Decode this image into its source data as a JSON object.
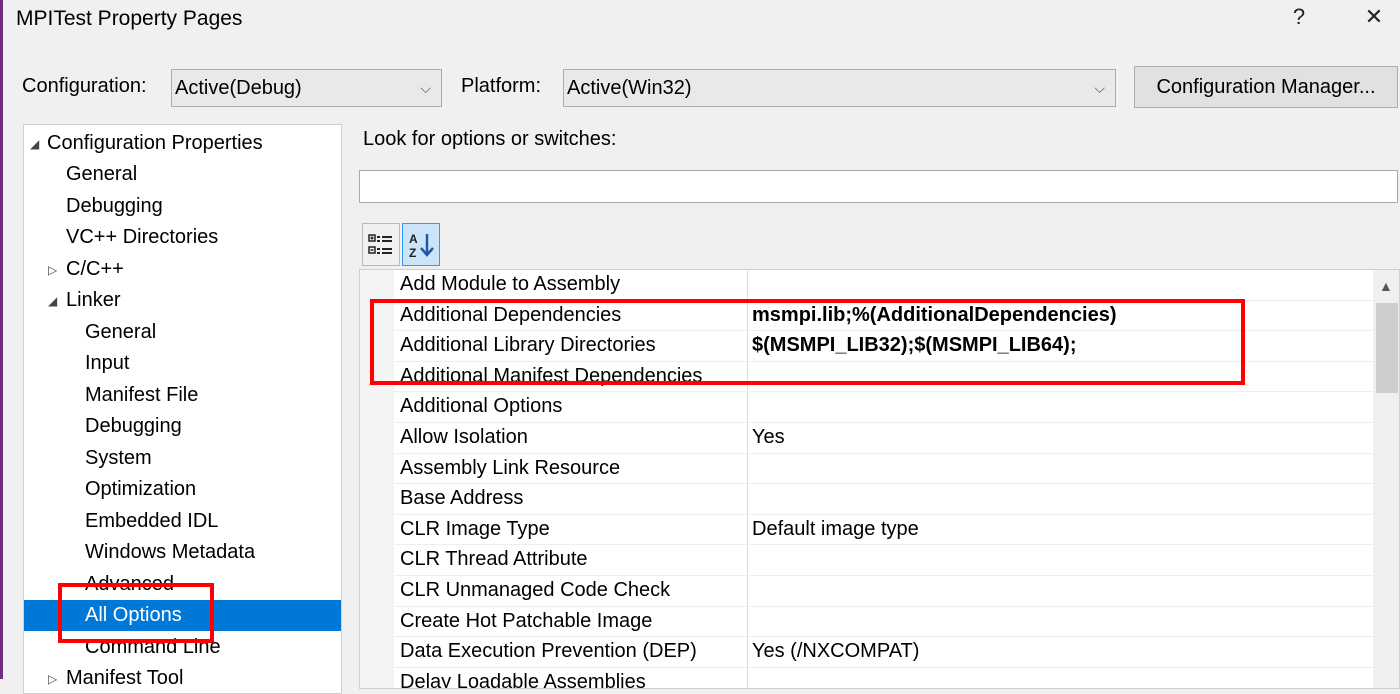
{
  "window": {
    "title": "MPITest Property Pages",
    "help_glyph": "?",
    "close_glyph": "✕"
  },
  "config": {
    "configuration_label": "Configuration:",
    "configuration_value": "Active(Debug)",
    "platform_label": "Platform:",
    "platform_value": "Active(Win32)",
    "manager_button": "Configuration Manager..."
  },
  "tree": {
    "items": [
      {
        "label": "Configuration Properties",
        "twisty": "◢"
      },
      {
        "label": "General"
      },
      {
        "label": "Debugging"
      },
      {
        "label": "VC++ Directories"
      },
      {
        "label": "C/C++",
        "twisty": "▷"
      },
      {
        "label": "Linker",
        "twisty": "◢"
      },
      {
        "label": "General"
      },
      {
        "label": "Input"
      },
      {
        "label": "Manifest File"
      },
      {
        "label": "Debugging"
      },
      {
        "label": "System"
      },
      {
        "label": "Optimization"
      },
      {
        "label": "Embedded IDL"
      },
      {
        "label": "Windows Metadata"
      },
      {
        "label": "Advanced"
      },
      {
        "label": "All Options",
        "selected": true
      },
      {
        "label": "Command Line"
      },
      {
        "label": "Manifest Tool",
        "twisty": "▷"
      }
    ]
  },
  "search": {
    "label": "Look for options or switches:",
    "value": ""
  },
  "toolbar": {
    "categorized_icon": "categorized-view-icon",
    "alphabetical_icon": "sort-alphabetical-icon"
  },
  "grid": {
    "rows": [
      {
        "name": "Add Module to Assembly",
        "value": ""
      },
      {
        "name": "Additional Dependencies",
        "value": "msmpi.lib;%(AdditionalDependencies)",
        "bold": true
      },
      {
        "name": "Additional Library Directories",
        "value": "$(MSMPI_LIB32);$(MSMPI_LIB64);",
        "bold": true
      },
      {
        "name": "Additional Manifest Dependencies",
        "value": ""
      },
      {
        "name": "Additional Options",
        "value": ""
      },
      {
        "name": "Allow Isolation",
        "value": "Yes"
      },
      {
        "name": "Assembly Link Resource",
        "value": ""
      },
      {
        "name": "Base Address",
        "value": ""
      },
      {
        "name": "CLR Image Type",
        "value": "Default image type"
      },
      {
        "name": "CLR Thread Attribute",
        "value": ""
      },
      {
        "name": "CLR Unmanaged Code Check",
        "value": ""
      },
      {
        "name": "Create Hot Patchable Image",
        "value": ""
      },
      {
        "name": "Data Execution Prevention (DEP)",
        "value": "Yes (/NXCOMPAT)"
      },
      {
        "name": "Delay Loadable Assemblies",
        "value": ""
      }
    ]
  },
  "colors": {
    "selection": "#0078d7",
    "annotation": "#ff0000",
    "window_edge": "#6e2d7e"
  }
}
